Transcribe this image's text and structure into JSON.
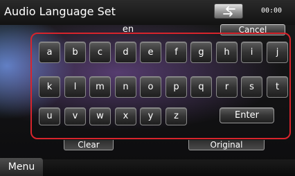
{
  "header": {
    "title": "Audio Language Set",
    "clock": "00:00",
    "back_icon": "back-arrow-icon"
  },
  "input": {
    "value": "en"
  },
  "buttons": {
    "cancel": "Cancel",
    "enter": "Enter",
    "clear": "Clear",
    "original": "Original",
    "menu": "Menu"
  },
  "keyboard": {
    "rows": [
      [
        "a",
        "b",
        "c",
        "d",
        "e",
        "f",
        "g",
        "h",
        "i",
        "j"
      ],
      [
        "k",
        "l",
        "m",
        "n",
        "o",
        "p",
        "q",
        "r",
        "s",
        "t"
      ],
      [
        "u",
        "v",
        "w",
        "x",
        "y",
        "z"
      ]
    ]
  },
  "colors": {
    "highlight": "#d8242c"
  }
}
